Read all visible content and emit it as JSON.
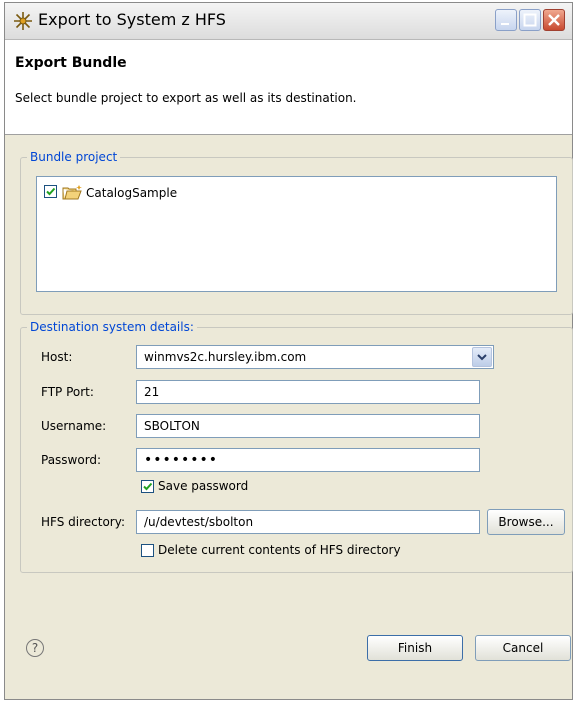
{
  "window": {
    "title": "Export to System z HFS"
  },
  "header": {
    "title": "Export Bundle",
    "description": "Select bundle project to export as well as its destination."
  },
  "bundle_project": {
    "legend": "Bundle project",
    "items": [
      {
        "label": "CatalogSample",
        "checked": true
      }
    ]
  },
  "destination": {
    "legend": "Destination system details:",
    "host_label": "Host:",
    "host_value": "winmvs2c.hursley.ibm.com",
    "ftp_port_label": "FTP Port:",
    "ftp_port_value": "21",
    "username_label": "Username:",
    "username_value": "SBOLTON",
    "password_label": "Password:",
    "password_value": "••••••••",
    "save_password_label": "Save password",
    "save_password_checked": true,
    "hfs_label": "HFS directory:",
    "hfs_value": "/u/devtest/sbolton",
    "browse_label": "Browse...",
    "delete_label": "Delete current contents of HFS directory",
    "delete_checked": false
  },
  "footer": {
    "help_glyph": "?",
    "finish_label": "Finish",
    "cancel_label": "Cancel"
  },
  "colors": {
    "legend": "#0046d5",
    "dialog_bg": "#ece9d8",
    "field_border": "#7f9db9"
  }
}
